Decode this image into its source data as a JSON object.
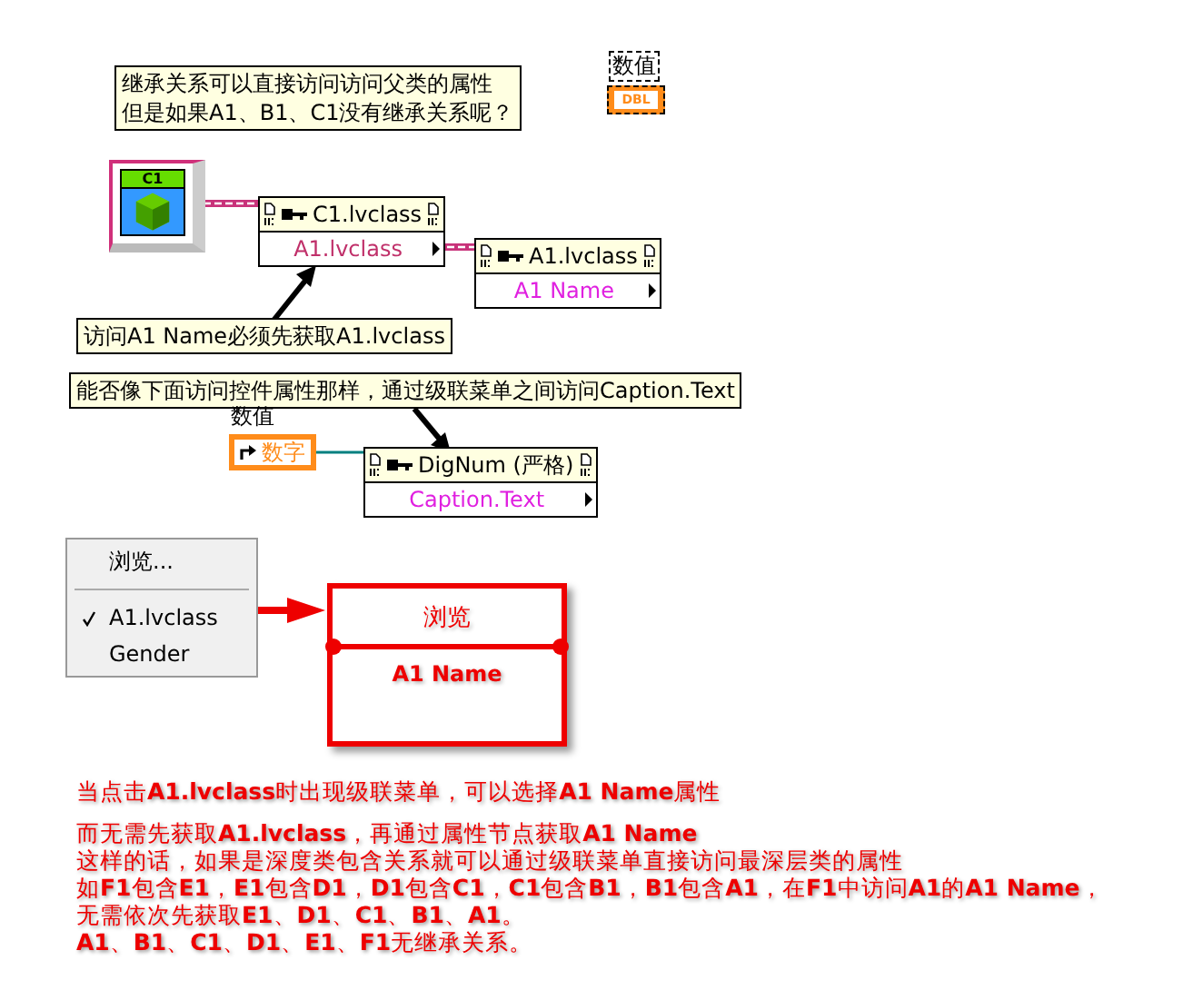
{
  "comments": [
    {
      "lines": [
        "继承关系可以直接访问访问父类的属性",
        "但是如果A1、B1、C1没有继承关系呢？"
      ]
    },
    {
      "lines": [
        "访问A1 Name必须先获取A1.lvclass"
      ]
    },
    {
      "lines": [
        "能否像下面访问控件属性那样，通过级联菜单之间访问Caption.Text"
      ]
    }
  ],
  "numeric_indicator": {
    "label": "数值",
    "terminal": "DBL"
  },
  "class_constant": {
    "label": "C1"
  },
  "property_nodes": [
    {
      "class": "C1.lvclass",
      "property": "A1.lvclass"
    },
    {
      "class": "A1.lvclass",
      "property": "A1 Name"
    },
    {
      "class": "DigNum (严格)",
      "property": "Caption.Text"
    }
  ],
  "control": {
    "label": "数值",
    "text": "数字"
  },
  "menu": {
    "items": [
      {
        "kind": "item",
        "label": "浏览...",
        "checked": false
      },
      {
        "kind": "separator"
      },
      {
        "kind": "item",
        "label": "A1.lvclass",
        "checked": true
      },
      {
        "kind": "item",
        "label": "Gender",
        "checked": false
      }
    ]
  },
  "callout": {
    "header": "浏览",
    "property": "A1 Name"
  },
  "notes": [
    {
      "lines": [
        "当点击**A1.lvclass**时出现级联菜单，可以选择**A1 Name**属性"
      ]
    },
    {
      "lines": [
        "而无需先获取**A1.lvclass**，再通过属性节点获取**A1 Name**",
        "这样的话，如果是深度类包含关系就可以通过级联菜单直接访问最深层类的属性",
        "如**F1**包含**E1**，**E1**包含**D1**，**D1**包含**C1**，**C1**包含**B1**，**B1**包含**A1**，在**F1**中访问**A1**的**A1 Name**，",
        "无需依次先获取**E1**、**D1**、**C1**、**B1**、**A1**。",
        "**A1**、**B1**、**C1**、**D1**、**E1**、**F1**无继承关系。"
      ]
    }
  ]
}
